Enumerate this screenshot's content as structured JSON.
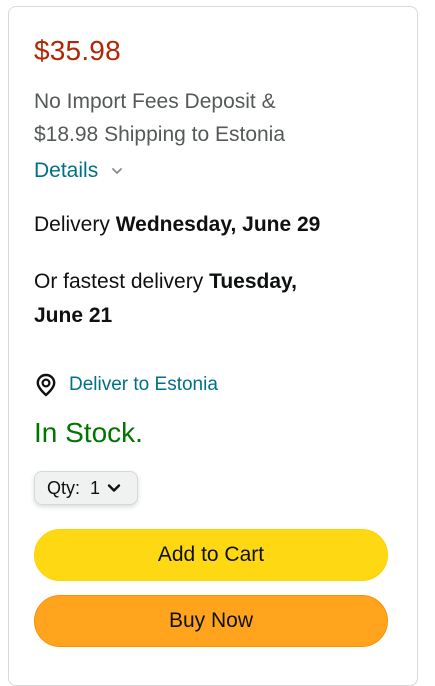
{
  "price": "$35.98",
  "fees": {
    "line1": "No Import Fees Deposit &",
    "line2": "$18.98 Shipping to Estonia"
  },
  "details": {
    "label": "Details",
    "chevron_icon": "chevron-down-icon"
  },
  "delivery": {
    "prefix": "Delivery",
    "date": "Wednesday, June 29"
  },
  "fastest": {
    "prefix": "Or fastest delivery",
    "date_part1": "Tuesday,",
    "date_part2": "June 21"
  },
  "deliver_to": {
    "label": "Deliver to Estonia",
    "icon": "location-pin-icon"
  },
  "stock": "In Stock.",
  "qty": {
    "label": "Qty:",
    "value": "1",
    "chevron_icon": "chevron-down-icon"
  },
  "buttons": {
    "add_to_cart": "Add to Cart",
    "buy_now": "Buy Now"
  },
  "colors": {
    "price": "#b12704",
    "link": "#007185",
    "stock": "#007600",
    "add_to_cart_bg": "#ffd814",
    "buy_now_bg": "#ffa41c"
  }
}
